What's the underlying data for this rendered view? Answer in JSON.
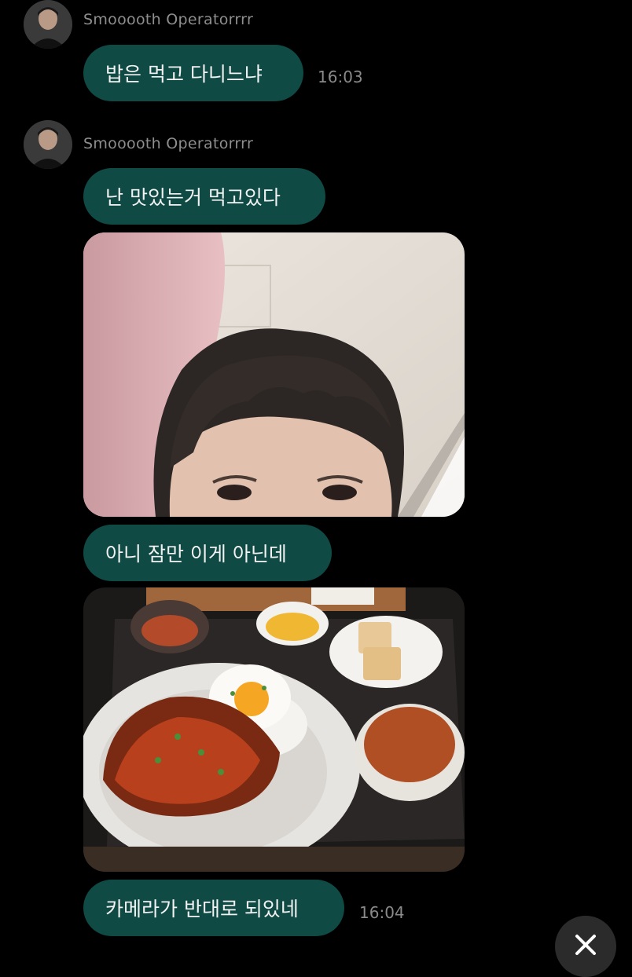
{
  "messages": [
    {
      "sender": "Smooooth Operatorrrr",
      "text": "밥은 먹고 다니느냐",
      "time": "16:03"
    },
    {
      "sender": "Smooooth Operatorrrr",
      "text": "난 맛있는거 먹고있다"
    },
    {
      "text": "아니 잠만 이게 아닌데"
    },
    {
      "text": "카메라가 반대로 되있네",
      "time": "16:04"
    }
  ],
  "photos": {
    "selfie": "selfie-photo",
    "meal": "meal-photo"
  },
  "icons": {
    "close": "close-icon"
  },
  "colors": {
    "background": "#000000",
    "bubble": "#0f4a44",
    "meta_text": "#8a8a8a"
  }
}
